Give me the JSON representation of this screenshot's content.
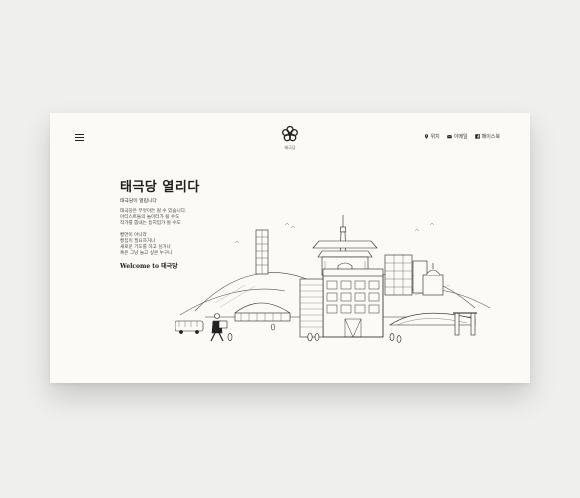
{
  "header": {
    "logo_text": "태극당",
    "nav": [
      {
        "label": "위치",
        "icon": "map-pin-icon"
      },
      {
        "label": "이메일",
        "icon": "mail-icon"
      },
      {
        "label": "페이스북",
        "icon": "facebook-icon"
      }
    ]
  },
  "hero": {
    "title": "태극당 열리다",
    "subtitle": "태극당이 열립니다",
    "paragraph1": [
      "태극당은 무엇이든 될 수 있습니다.",
      "아티스트들의 놀이터가 될 수도",
      "작가를 뽑내는 등지입가 될 수도"
    ],
    "paragraph2": [
      "빵만이 아니라",
      "빵집이 필요하거나",
      "새로운 기도를 하고 싶거나",
      "혹은 그냥 놀고 싶은 누구나"
    ],
    "welcome": "Welcome to 태극당"
  },
  "colors": {
    "background": "#efefed",
    "card": "#fbfaf6",
    "ink": "#1e1e1e"
  }
}
